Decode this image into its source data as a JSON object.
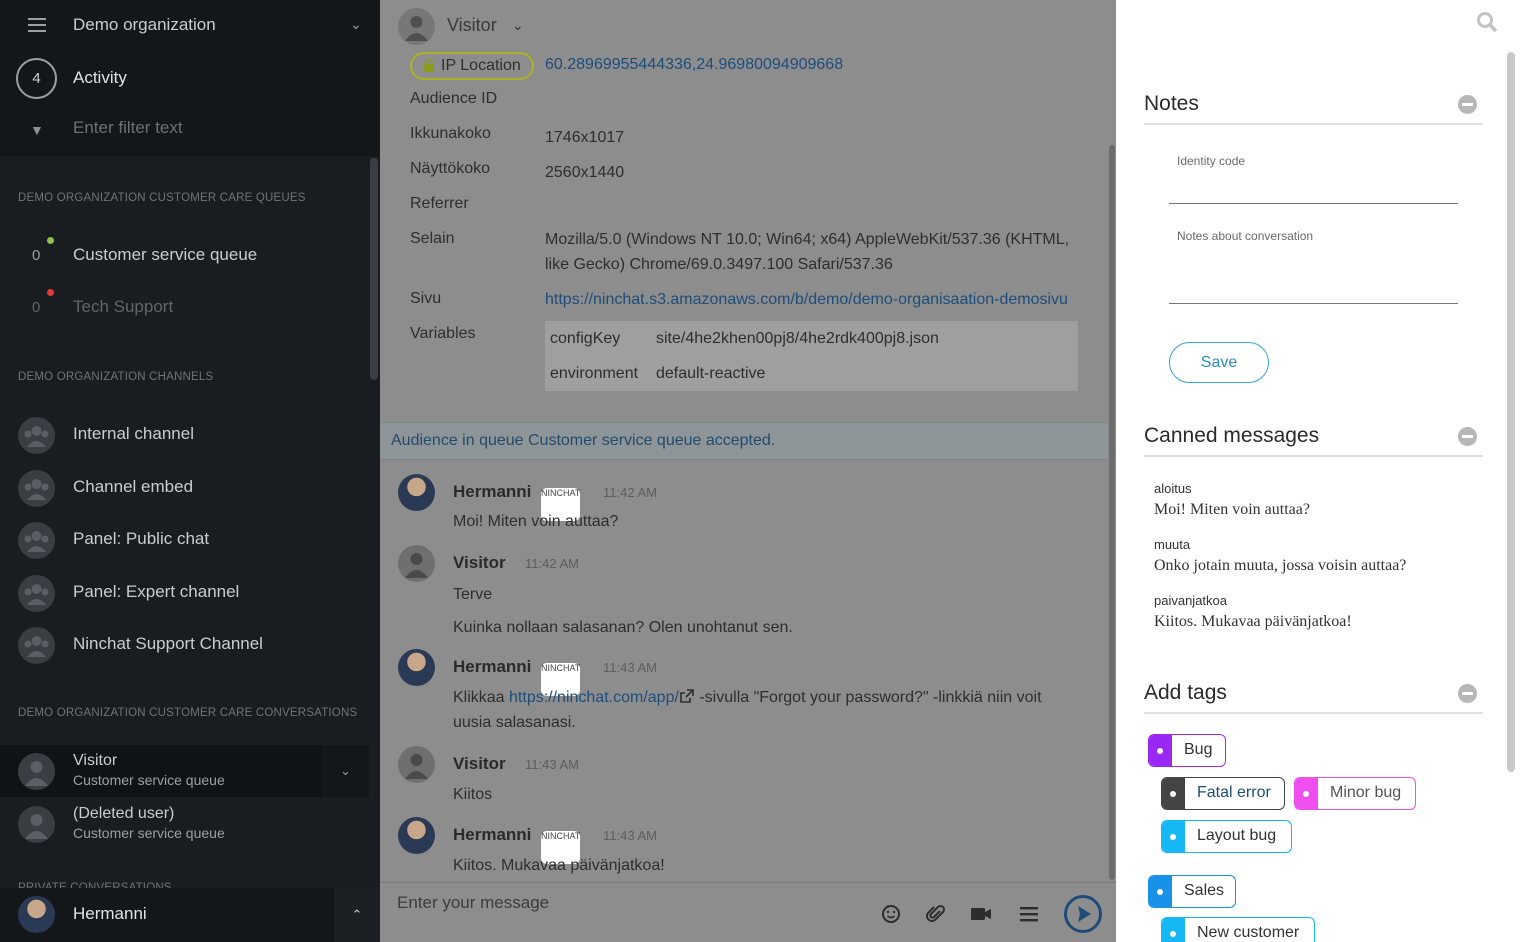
{
  "sidebar": {
    "org_name": "Demo organization",
    "activity_count": "4",
    "activity_label": "Activity",
    "filter_placeholder": "Enter filter text",
    "queues_heading": "DEMO ORGANIZATION CUSTOMER CARE QUEUES",
    "queues": [
      {
        "count": "0",
        "name": "Customer service queue",
        "status_color": "#8bc34a",
        "active": true
      },
      {
        "count": "0",
        "name": "Tech Support",
        "status_color": "#e53935",
        "active": false
      }
    ],
    "channels_heading": "DEMO ORGANIZATION CHANNELS",
    "channels": [
      {
        "name": "Internal channel"
      },
      {
        "name": "Channel embed"
      },
      {
        "name": "Panel: Public chat"
      },
      {
        "name": "Panel: Expert channel"
      },
      {
        "name": "Ninchat Support Channel"
      }
    ],
    "conversations_heading": "DEMO ORGANIZATION CUSTOMER CARE CONVERSATIONS",
    "conversations": [
      {
        "name": "Visitor",
        "queue": "Customer service queue"
      },
      {
        "name": "(Deleted user)",
        "queue": "Customer service queue"
      }
    ],
    "private_heading": "PRIVATE CONVERSATIONS",
    "user_name": "Hermanni"
  },
  "chat": {
    "header_name": "Visitor",
    "info": {
      "ip_label": "IP Location",
      "ip_value": "60.28969955444336,24.96980094909668",
      "rows": [
        {
          "label": "Audience ID",
          "value": ""
        },
        {
          "label": "Ikkunakoko",
          "value": "1746x1017"
        },
        {
          "label": "Näyttökoko",
          "value": "2560x1440"
        },
        {
          "label": "Referrer",
          "value": ""
        },
        {
          "label": "Selain",
          "value": "Mozilla/5.0 (Windows NT 10.0; Win64; x64) AppleWebKit/537.36 (KHTML, like Gecko) Chrome/69.0.3497.100 Safari/537.36"
        },
        {
          "label": "Sivu",
          "value": "https://ninchat.s3.amazonaws.com/b/demo/demo-organisaation-demosivu"
        },
        {
          "label": "Variables",
          "value": ""
        }
      ],
      "variables": [
        {
          "key": "configKey",
          "value": "site/4he2khen00pj8/4he2rdk400pj8.json"
        },
        {
          "key": "environment",
          "value": "default-reactive"
        }
      ]
    },
    "system_message": "Audience in queue Customer service queue accepted.",
    "messages": [
      {
        "author": "Hermanni",
        "tag": "NINCHAT",
        "time": "11:42 AM",
        "lines": [
          "Moi! Miten voin auttaa?"
        ]
      },
      {
        "author": "Visitor",
        "tag": "",
        "time": "11:42 AM",
        "lines": [
          "Terve",
          "Kuinka nollaan salasanan? Olen unohtanut sen."
        ]
      },
      {
        "author": "Hermanni",
        "tag": "NINCHAT",
        "time": "11:43 AM",
        "lines": []
      },
      {
        "author": "Visitor",
        "tag": "",
        "time": "11:43 AM",
        "lines": [
          "Kiitos"
        ]
      },
      {
        "author": "Hermanni",
        "tag": "NINCHAT",
        "time": "11:43 AM",
        "lines": [
          "Kiitos. Mukavaa päivänjatkoa!"
        ]
      }
    ],
    "link_message": {
      "prefix": "Klikkaa ",
      "link": "https://ninchat.com/app/",
      "suffix_line1": " -sivulla \"Forgot your password?\" -linkkiä niin voit",
      "line2": "uusia salasanasi."
    },
    "composer_placeholder": "Enter your message"
  },
  "panel": {
    "notes_title": "Notes",
    "identity_label": "Identity code",
    "notes_label": "Notes about conversation",
    "save_label": "Save",
    "canned_title": "Canned messages",
    "canned": [
      {
        "name": "aloitus",
        "message": "Moi! Miten voin auttaa?"
      },
      {
        "name": "muuta",
        "message": "Onko jotain muuta, jossa voisin auttaa?"
      },
      {
        "name": "paivanjatkoa",
        "message": "Kiitos. Mukavaa päivänjatkoa!"
      }
    ],
    "tags_title": "Add tags",
    "tags": [
      {
        "label": "Bug",
        "color": "#9b27f5",
        "text_color": "#333"
      },
      {
        "label": "Fatal error",
        "color": "#444444",
        "text_color": "#1d4e7a"
      },
      {
        "label": "Minor bug",
        "color": "#f04ff0",
        "text_color": "#555"
      },
      {
        "label": "Layout bug",
        "color": "#15b8f5",
        "text_color": "#333"
      },
      {
        "label": "Sales",
        "color": "#1891e8",
        "text_color": "#333"
      },
      {
        "label": "New customer",
        "color": "#15b8f5",
        "text_color": "#333"
      }
    ]
  }
}
